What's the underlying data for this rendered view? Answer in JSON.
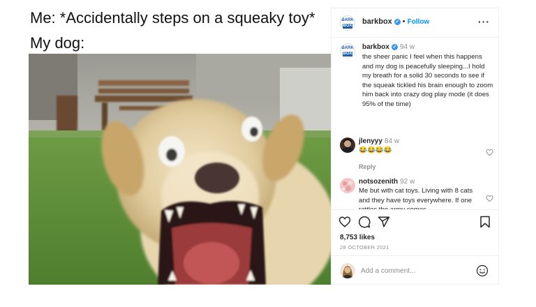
{
  "meme": {
    "caption_line1": "Me: *Accidentally steps on a squeaky toy*",
    "caption_line2": "My dog:"
  },
  "post_header": {
    "username": "barkbox",
    "verified": true,
    "separator": "•",
    "follow_label": "Follow",
    "more_label": "···",
    "logo_text_top": "BARK",
    "logo_text_bottom": "BOX"
  },
  "caption": {
    "username": "barkbox",
    "time": "94 w",
    "text": "the sheer panic I feel when this happens and my dog is peacefully sleeping...I hold my breath for a solid 30 seconds to see if the squeak tickled his brain enough to zoom him back into crazy dog play mode (it does 95% of the time)"
  },
  "comments": [
    {
      "username": "jlenyyy",
      "time": "84 w",
      "text": "😂😂😂😂",
      "reply_label": "Reply"
    },
    {
      "username": "notsozenith",
      "time": "92 w",
      "text": "Me but with cat toys. Living with 8 cats and they have toys everywhere. If one rattles the army comes"
    }
  ],
  "actions": {
    "likes": "8,753 likes",
    "date": "28 OCTOBER 2021",
    "icons": [
      "heart-icon",
      "comment-icon",
      "share-icon",
      "bookmark-icon"
    ]
  },
  "add_comment": {
    "placeholder": "Add a comment...",
    "emoji_icon": "smiley-icon"
  },
  "colors": {
    "accent": "#0095f6",
    "verified": "#3897f0",
    "muted": "#8e8e8e",
    "border": "#efefef",
    "grass": "#5f8f3a",
    "dog_fur": "#d8c49a"
  }
}
